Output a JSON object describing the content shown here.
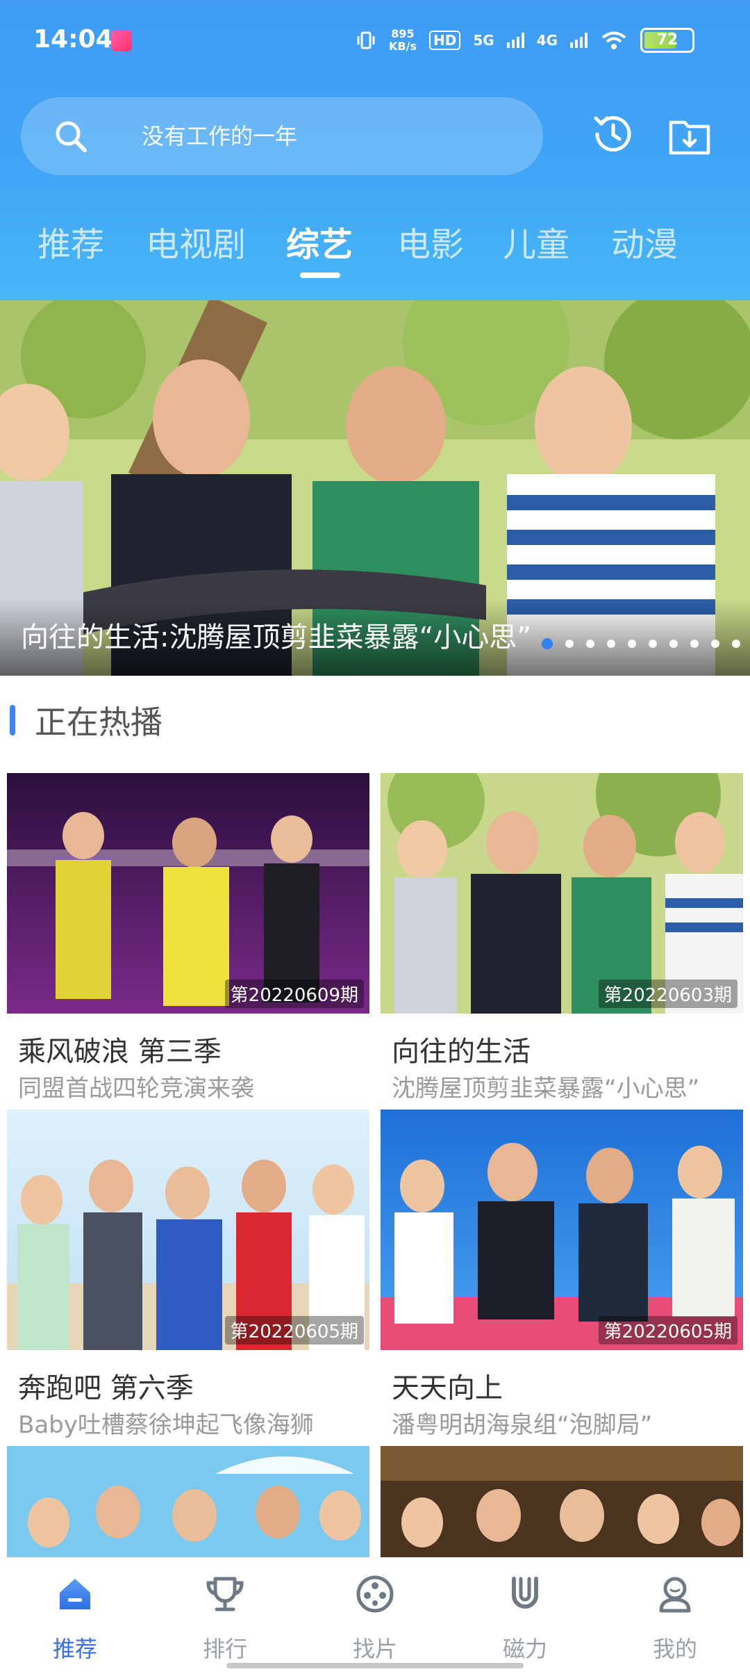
{
  "status_bar": {
    "time": "14:04",
    "net_speed_value": "895",
    "net_speed_unit": "KB/s",
    "hd_label": "HD",
    "sim1_label": "5G",
    "sim2_label": "4G",
    "battery": "72"
  },
  "search": {
    "placeholder": "没有工作的一年"
  },
  "tabs": [
    {
      "label": "推荐"
    },
    {
      "label": "电视剧"
    },
    {
      "label": "综艺"
    },
    {
      "label": "电影"
    },
    {
      "label": "儿童"
    },
    {
      "label": "动漫"
    }
  ],
  "active_tab": "综艺",
  "banner": {
    "caption": "向往的生活:沈腾屋顶剪韭菜暴露“小心思”",
    "dot_count": 10,
    "active_dot": 0
  },
  "section": {
    "title": "正在热播"
  },
  "cards": [
    {
      "title": "乘风破浪 第三季",
      "subtitle": "同盟首战四轮竞演来袭",
      "episode": "第20220609期"
    },
    {
      "title": "向往的生活",
      "subtitle": "沈腾屋顶剪韭菜暴露“小心思”",
      "episode": "第20220603期"
    },
    {
      "title": "奔跑吧 第六季",
      "subtitle": "Baby吐槽蔡徐坤起飞像海狮",
      "episode": "第20220605期"
    },
    {
      "title": "天天向上",
      "subtitle": "潘粤明胡海泉组“泡脚局”",
      "episode": "第20220605期"
    }
  ],
  "bottom_nav": [
    {
      "label": "推荐",
      "icon": "home-icon"
    },
    {
      "label": "排行",
      "icon": "trophy-icon"
    },
    {
      "label": "找片",
      "icon": "film-reel-icon"
    },
    {
      "label": "磁力",
      "icon": "magnet-icon"
    },
    {
      "label": "我的",
      "icon": "user-icon"
    }
  ],
  "colors": {
    "header_blue": "#40a6f6",
    "accent": "#3470e8",
    "section_bar": "#3a86f0"
  }
}
